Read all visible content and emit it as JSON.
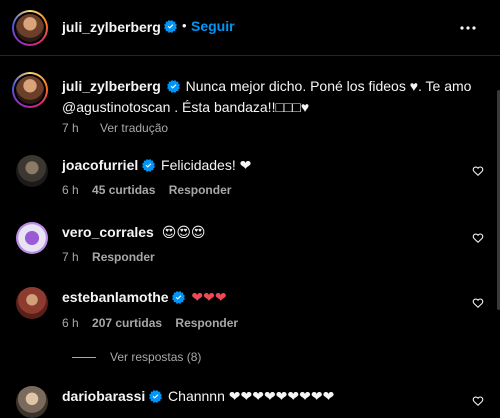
{
  "post": {
    "author": "juli_zylberberg",
    "dot": "•",
    "follow_label": "Seguir",
    "caption_text": "Nunca mejor dicho. Poné los fideos ♥. Te amo @agustinotoscan . Ésta bandaza!!□□□♥",
    "caption_line1": "Nunca mejor dicho. Poné los fideos ♥. Te amo",
    "caption_line2": "@agustinotoscan . Ésta bandaza!!□□□♥",
    "time": "7 h",
    "see_translation": "Ver tradução"
  },
  "comments": [
    {
      "user": "joacofurriel",
      "text": "Felicidades! ❤",
      "time": "6 h",
      "likes": "45 curtidas",
      "reply": "Responder"
    },
    {
      "user": "vero_corrales",
      "text": "😍😍😍",
      "time": "7 h",
      "reply": "Responder"
    },
    {
      "user": "estebanlamothe",
      "text": "❤❤❤",
      "time": "6 h",
      "likes": "207 curtidas",
      "reply": "Responder",
      "view_replies": "Ver respostas (8)"
    },
    {
      "user": "dariobarassi",
      "text": "Channnn ❤❤❤❤❤❤❤❤❤"
    }
  ],
  "colors": {
    "background": "#000000",
    "link": "#0095f6",
    "muted": "#a8a8a8",
    "heart_red": "#ed4956",
    "verified": "#0095f6"
  },
  "icons": [
    "more-options-icon",
    "verified-badge-icon",
    "heart-outline-icon"
  ]
}
